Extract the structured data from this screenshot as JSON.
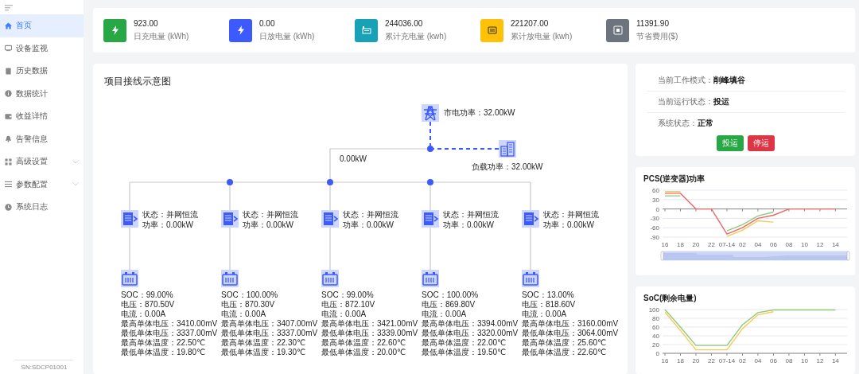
{
  "sidebar": {
    "items": [
      {
        "label": "首页",
        "selected": true,
        "expandable": false
      },
      {
        "label": "设备监视",
        "selected": false,
        "expandable": false
      },
      {
        "label": "历史数据",
        "selected": false,
        "expandable": false
      },
      {
        "label": "数据统计",
        "selected": false,
        "expandable": false
      },
      {
        "label": "收益详情",
        "selected": false,
        "expandable": false
      },
      {
        "label": "告警信息",
        "selected": false,
        "expandable": false
      },
      {
        "label": "高级设置",
        "selected": false,
        "expandable": true
      },
      {
        "label": "参数配置",
        "selected": false,
        "expandable": true
      },
      {
        "label": "系统日志",
        "selected": false,
        "expandable": false
      }
    ],
    "serial": "SN:SDCP01001"
  },
  "stats": [
    {
      "value": "923.00",
      "label": "日充电量 (kWh)",
      "color": "#28a745"
    },
    {
      "value": "0.00",
      "label": "日放电量 (kWh)",
      "color": "#3d5afe"
    },
    {
      "value": "244036.00",
      "label": "累计充电量 (kwh)",
      "color": "#17a2b8"
    },
    {
      "value": "221207.00",
      "label": "累计放电量 (kwh)",
      "color": "#ffc107"
    },
    {
      "value": "11391.90",
      "label": "节省费用($)",
      "color": "#6c757d"
    }
  ],
  "diagram": {
    "title": "项目接线示意图",
    "grid_label": "市电功率：32.00kW",
    "bus_power": "0.00kW",
    "load_label": "负载功率：32.00kW",
    "branches": [
      {
        "pcs": [
          "状态：并网恒流",
          "功率：0.00kW"
        ],
        "battery": [
          "SOC：99.00%",
          "电压：870.50V",
          "电流：0.00A",
          "最高单体电压：3410.00mV",
          "最低单体电压：3337.00mV",
          "最高单体温度：22.50℃",
          "最低单体温度：19.80℃"
        ]
      },
      {
        "pcs": [
          "状态：并网恒流",
          "功率：0.00kW"
        ],
        "battery": [
          "SOC：100.00%",
          "电压：870.30V",
          "电流：0.00A",
          "最高单体电压：3407.00mV",
          "最低单体电压：3337.00mV",
          "最高单体温度：22.30℃",
          "最低单体温度：19.30℃"
        ]
      },
      {
        "pcs": [
          "状态：并网恒流",
          "功率：0.00kW"
        ],
        "battery": [
          "SOC：99.00%",
          "电压：872.10V",
          "电流：0.00A",
          "最高单体电压：3421.00mV",
          "最低单体电压：3339.00mV",
          "最高单体温度：22.60℃",
          "最低单体温度：20.00℃"
        ]
      },
      {
        "pcs": [
          "状态：并网恒流",
          "功率：0.00kW"
        ],
        "battery": [
          "SOC：100.00%",
          "电压：869.80V",
          "电流：0.00A",
          "最高单体电压：3394.00mV",
          "最低单体电压：3320.00mV",
          "最高单体温度：22.00℃",
          "最低单体温度：19.50℃"
        ]
      },
      {
        "pcs": [
          "状态：并网恒流",
          "功率：0.00kW"
        ],
        "battery": [
          "SOC：13.00%",
          "电压：818.60V",
          "电流：0.00A",
          "最高单体电压：3160.00mV",
          "最低单体电压：3064.00mV",
          "最高单体温度：25.60℃",
          "最低单体温度：22.60℃"
        ]
      }
    ]
  },
  "status": {
    "rows": [
      {
        "label": "当前工作模式：",
        "value": "削峰填谷"
      },
      {
        "label": "当前运行状态：",
        "value": "投运"
      },
      {
        "label": "系统状态：",
        "value": "正常"
      }
    ],
    "buttons": [
      {
        "label": "投运",
        "kind": "start"
      },
      {
        "label": "停运",
        "kind": "stop"
      }
    ]
  },
  "pcs_chart": {
    "title": "PCS(逆变器)功率",
    "zoom_slider": {
      "level": 1
    },
    "chart_data": {
      "type": "line",
      "grid": true,
      "categories": [
        "16",
        "18",
        "20",
        "22",
        "07-14",
        "02",
        "04",
        "06",
        "08",
        "10",
        "12",
        "14"
      ],
      "ylim": [
        -90,
        60
      ],
      "yticks": [
        60,
        30,
        0,
        -30,
        -60,
        -90
      ],
      "series": [
        {
          "color": "#91cc75",
          "values": [
            42,
            42,
            null,
            null,
            -70,
            -50,
            -22,
            -10,
            null,
            null,
            null,
            null
          ]
        },
        {
          "color": "#fac858",
          "values": [
            56,
            56,
            null,
            null,
            -88,
            -68,
            -38,
            -42,
            null,
            null,
            null,
            null
          ]
        },
        {
          "color": "#ee6666",
          "values": [
            50,
            50,
            0,
            0,
            -80,
            -60,
            -30,
            -20,
            0,
            0,
            0,
            0
          ]
        }
      ]
    }
  },
  "soc_chart": {
    "title": "SoC(剩余电量)",
    "chart_data": {
      "type": "line",
      "grid": true,
      "categories": [
        "16",
        "18",
        "20",
        "22",
        "07-14",
        "02",
        "04",
        "06",
        "08",
        "10",
        "12",
        "14"
      ],
      "ylim": [
        0,
        100
      ],
      "yticks": [
        0,
        20,
        40,
        60,
        80,
        100
      ],
      "series": [
        {
          "color": "#fac858",
          "values": [
            94,
            52,
            8,
            8,
            8,
            56,
            88,
            95,
            null,
            null,
            null,
            null
          ]
        },
        {
          "color": "#91cc75",
          "values": [
            100,
            60,
            18,
            18,
            18,
            65,
            93,
            99,
            99,
            99,
            99,
            99
          ]
        }
      ]
    }
  }
}
